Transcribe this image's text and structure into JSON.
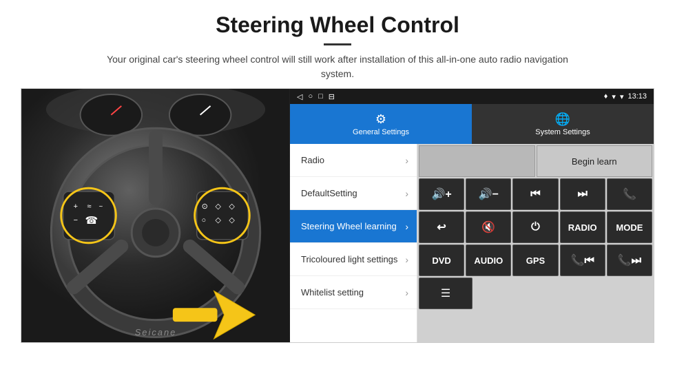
{
  "header": {
    "title": "Steering Wheel Control",
    "subtitle": "Your original car's steering wheel control will still work after installation of this all-in-one auto radio navigation system."
  },
  "status_bar": {
    "time": "13:13",
    "icons": [
      "◁",
      "○",
      "□",
      "⊟"
    ]
  },
  "tabs": [
    {
      "label": "General Settings",
      "active": true
    },
    {
      "label": "System Settings",
      "active": false
    }
  ],
  "menu_items": [
    {
      "label": "Radio",
      "active": false
    },
    {
      "label": "DefaultSetting",
      "active": false
    },
    {
      "label": "Steering Wheel learning",
      "active": true
    },
    {
      "label": "Tricoloured light settings",
      "active": false
    },
    {
      "label": "Whitelist setting",
      "active": false
    }
  ],
  "controls": {
    "begin_learn": "Begin learn",
    "row1": [
      "🔇+",
      "🔇-",
      "⏮",
      "⏭",
      "📞"
    ],
    "row2": [
      "↩",
      "🔇×",
      "⏻",
      "RADIO",
      "MODE"
    ],
    "row3": [
      "DVD",
      "AUDIO",
      "GPS",
      "📞⏮",
      "📞⏭"
    ]
  },
  "watermark": "Seicane"
}
